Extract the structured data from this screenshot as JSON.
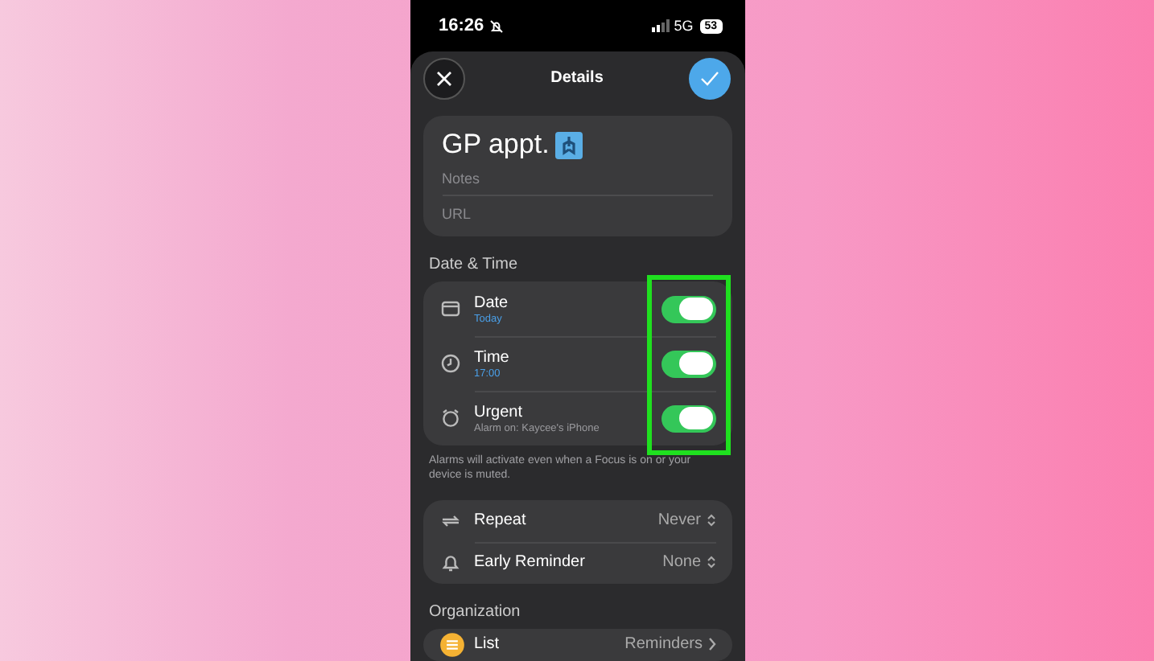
{
  "status_bar": {
    "time": "16:26",
    "network": "5G",
    "battery": "53"
  },
  "header": {
    "title": "Details"
  },
  "task": {
    "title": "GP appt.",
    "notes_placeholder": "Notes",
    "url_placeholder": "URL"
  },
  "date_time": {
    "heading": "Date & Time",
    "rows": [
      {
        "kind": "toggle",
        "label": "Date",
        "detail": "Today",
        "on": true
      },
      {
        "kind": "toggle",
        "label": "Time",
        "detail": "17:00",
        "on": true
      },
      {
        "kind": "toggle",
        "label": "Urgent",
        "detail": "Alarm on: Kaycee's iPhone",
        "on": true
      }
    ],
    "footnote": "Alarms will activate even when a Focus is on or your device is muted.",
    "highlighted": true
  },
  "options": [
    {
      "kind": "picker",
      "label": "Repeat",
      "value": "Never"
    },
    {
      "kind": "picker",
      "label": "Early Reminder",
      "value": "None"
    }
  ],
  "organization": {
    "heading": "Organization",
    "rows": [
      {
        "kind": "link",
        "label": "List",
        "value": "Reminders"
      }
    ]
  }
}
